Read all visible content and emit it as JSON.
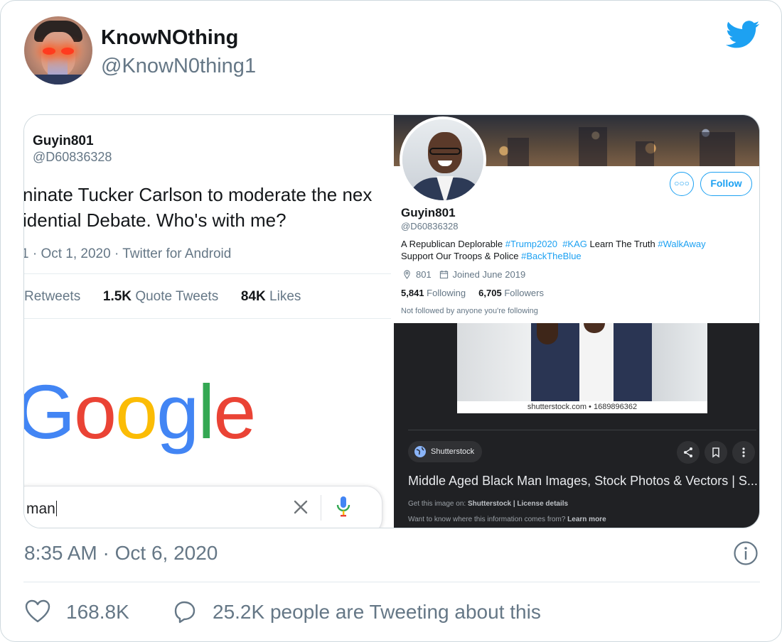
{
  "tweet": {
    "display_name": "KnowNOthing",
    "handle": "@KnowN0thing1",
    "timestamp": "8:35 AM · Oct 6, 2020",
    "like_count": "168.8K",
    "tweeting_text": "25.2K people are Tweeting about this",
    "brand_color": "#1DA1F2"
  },
  "screenshot_left": {
    "name": "Guyin801",
    "handle": "@D60836328",
    "text_line1": "ninate Tucker Carlson to moderate the nex",
    "text_line2": "idential Debate. Who's with me?",
    "meta": "1 · Oct 1, 2020 · Twitter for Android",
    "retweets_label": "Retweets",
    "quote_count": "1.5K",
    "quote_label": "Quote Tweets",
    "likes_count": "84K",
    "likes_label": "Likes",
    "google_logo": [
      "G",
      "o",
      "o",
      "g",
      "l",
      "e"
    ],
    "search_value": "man"
  },
  "screenshot_right": {
    "more_button": "○○○",
    "follow_button": "Follow",
    "name": "Guyin801",
    "handle": "@D60836328",
    "bio_text1": "A Republican Deplorable",
    "bio_tag1": "#Trump2020",
    "bio_tag2": "#KAG",
    "bio_text2": "Learn The Truth",
    "bio_tag3": "#WalkAway",
    "bio_text3": "Support Our Troops & Police",
    "bio_tag4": "#BackTheBlue",
    "location": "801",
    "joined": "Joined June 2019",
    "following_count": "5,841",
    "following_label": "Following",
    "followers_count": "6,705",
    "followers_label": "Followers",
    "not_followed": "Not followed by anyone you're following",
    "stock_caption": "shutterstock.com • 1689896362",
    "source_chip": "Shutterstock",
    "image_title": "Middle Aged Black Man Images, Stock Photos & Vectors | S...",
    "get_image_prefix": "Get this image on:",
    "get_image_source": "Shutterstock | License details",
    "want_to_know": "Want to know where this information comes from?",
    "learn_more": "Learn more"
  }
}
